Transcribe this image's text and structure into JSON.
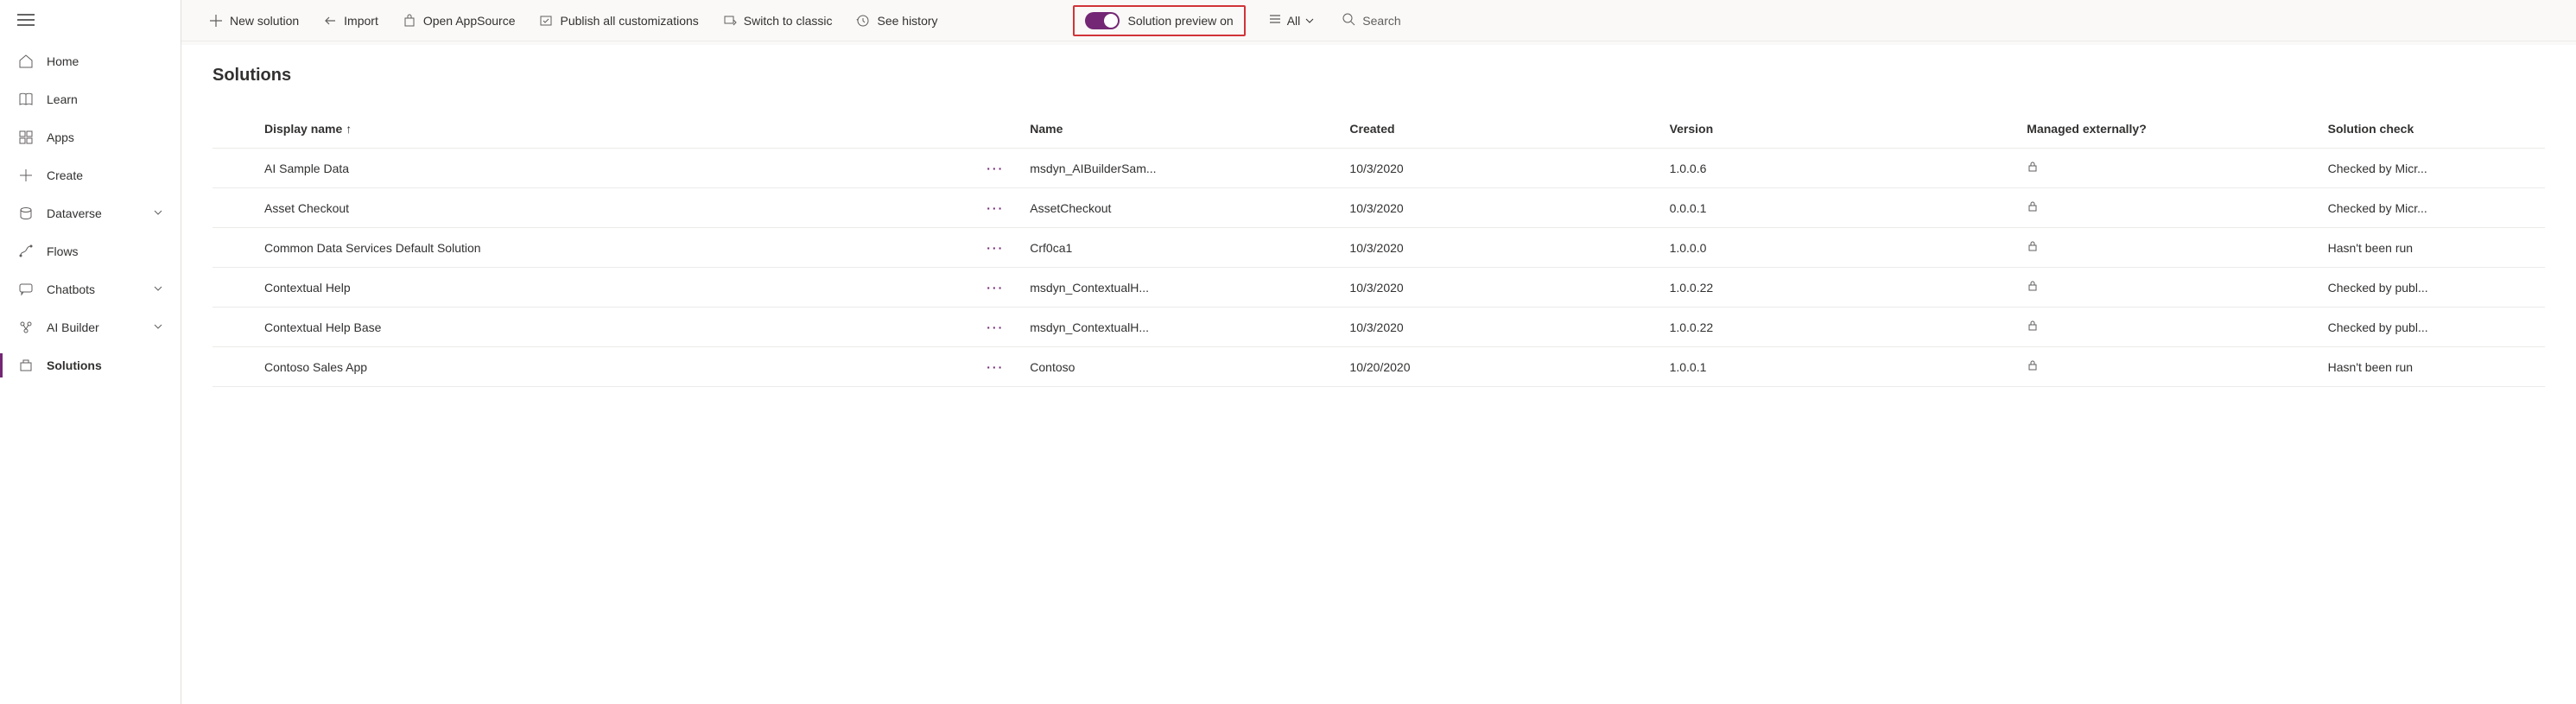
{
  "sidebar": {
    "items": [
      {
        "label": "Home",
        "icon": "home-icon"
      },
      {
        "label": "Learn",
        "icon": "book-icon"
      },
      {
        "label": "Apps",
        "icon": "grid-icon"
      },
      {
        "label": "Create",
        "icon": "plus-icon"
      },
      {
        "label": "Dataverse",
        "icon": "dataverse-icon",
        "chevron": true
      },
      {
        "label": "Flows",
        "icon": "flows-icon"
      },
      {
        "label": "Chatbots",
        "icon": "chat-icon",
        "chevron": true
      },
      {
        "label": "AI Builder",
        "icon": "ai-icon",
        "chevron": true
      },
      {
        "label": "Solutions",
        "icon": "solutions-icon",
        "active": true
      }
    ]
  },
  "commands": {
    "new_solution": "New solution",
    "import": "Import",
    "open_appsource": "Open AppSource",
    "publish_all": "Publish all customizations",
    "switch_classic": "Switch to classic",
    "see_history": "See history",
    "preview_toggle": "Solution preview on",
    "filter_all": "All",
    "search_placeholder": "Search"
  },
  "page": {
    "title": "Solutions"
  },
  "table": {
    "headers": {
      "display_name": "Display name",
      "name": "Name",
      "created": "Created",
      "version": "Version",
      "managed": "Managed externally?",
      "check": "Solution check"
    },
    "rows": [
      {
        "display": "AI Sample Data",
        "name": "msdyn_AIBuilderSam...",
        "created": "10/3/2020",
        "version": "1.0.0.6",
        "managed": true,
        "check": "Checked by Micr..."
      },
      {
        "display": "Asset Checkout",
        "name": "AssetCheckout",
        "created": "10/3/2020",
        "version": "0.0.0.1",
        "managed": true,
        "check": "Checked by Micr..."
      },
      {
        "display": "Common Data Services Default Solution",
        "name": "Crf0ca1",
        "created": "10/3/2020",
        "version": "1.0.0.0",
        "managed": true,
        "check": "Hasn't been run"
      },
      {
        "display": "Contextual Help",
        "name": "msdyn_ContextualH...",
        "created": "10/3/2020",
        "version": "1.0.0.22",
        "managed": true,
        "check": "Checked by publ..."
      },
      {
        "display": "Contextual Help Base",
        "name": "msdyn_ContextualH...",
        "created": "10/3/2020",
        "version": "1.0.0.22",
        "managed": true,
        "check": "Checked by publ..."
      },
      {
        "display": "Contoso Sales App",
        "name": "Contoso",
        "created": "10/20/2020",
        "version": "1.0.0.1",
        "managed": true,
        "check": "Hasn't been run"
      }
    ]
  }
}
